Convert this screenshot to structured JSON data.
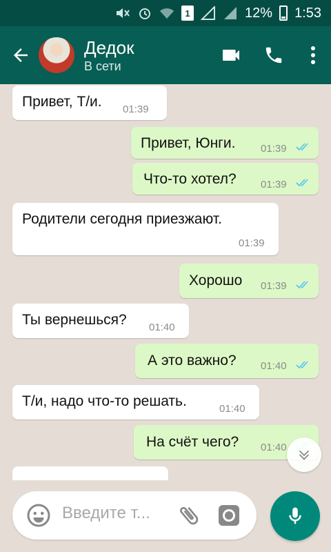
{
  "status_bar": {
    "battery": "12%",
    "time": "1:53",
    "sim": "1"
  },
  "header": {
    "title": "Дедок",
    "subtitle": "В сети"
  },
  "messages": [
    {
      "dir": "in",
      "text": "Привет, Т/и.",
      "time": "01:39"
    },
    {
      "dir": "out",
      "text": "Привет, Юнги.",
      "time": "01:39",
      "read": true
    },
    {
      "dir": "out",
      "text": "Что-то хотел?",
      "time": "01:39",
      "read": true
    },
    {
      "dir": "in",
      "text": "Родители сегодня приезжают.",
      "time": "01:39"
    },
    {
      "dir": "out",
      "text": "Хорошо",
      "time": "01:39",
      "read": true
    },
    {
      "dir": "in",
      "text": "Ты вернешься?",
      "time": "01:40"
    },
    {
      "dir": "out",
      "text": "А это важно?",
      "time": "01:40",
      "read": true
    },
    {
      "dir": "in",
      "text": "Т/и, надо что-то решать.",
      "time": "01:40"
    },
    {
      "dir": "out",
      "text": "На счёт чего?",
      "time": "01:40",
      "read": true
    }
  ],
  "composer": {
    "placeholder": "Введите т..."
  },
  "colors": {
    "header": "#075e54",
    "status": "#054d44",
    "outgoing": "#dcf8c6",
    "incoming": "#ffffff",
    "read_ticks": "#4fc3f7",
    "mic": "#00897b"
  },
  "icons": [
    "back-arrow-icon",
    "video-call-icon",
    "phone-icon",
    "more-vert-icon",
    "emoji-icon",
    "attach-icon",
    "camera-icon",
    "mic-icon",
    "scroll-down-icon"
  ]
}
